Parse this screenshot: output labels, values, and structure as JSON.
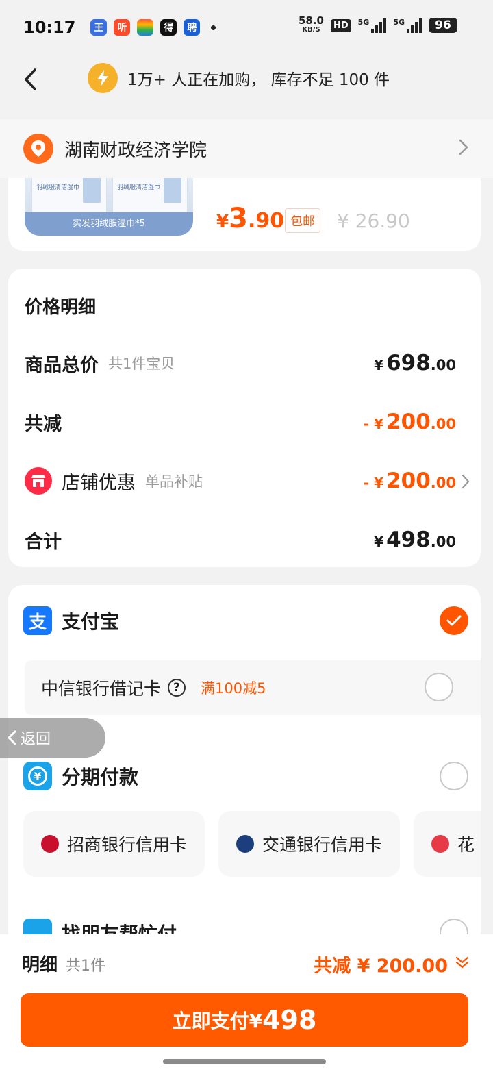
{
  "status_bar": {
    "time": "10:17",
    "net_speed": "58.0",
    "net_unit": "KB/S",
    "hd": "HD",
    "sim1": "5G",
    "sim2": "5G",
    "battery": "96"
  },
  "header": {
    "notice": "1万+ 人正在加购， 库存不足 100 件"
  },
  "address": {
    "text": "湖南财政经济学院"
  },
  "product": {
    "image_caption": "实发羽绒服湿巾*5",
    "pack_title": "羽绒服清洁湿巾",
    "price_currency": "¥",
    "price_int": "3",
    "price_dec": ".90",
    "shipping_tag": "包邮",
    "original_price": "¥ 26.90"
  },
  "price_detail": {
    "title": "价格明细",
    "goods_total": {
      "label": "商品总价",
      "sub": "共1件宝贝",
      "currency": "¥",
      "int": "698",
      "dec": ".00"
    },
    "total_discount": {
      "label": "共减",
      "currency": "- ¥",
      "int": "200",
      "dec": ".00"
    },
    "shop_discount": {
      "label": "店铺优惠",
      "sub": "单品补贴",
      "currency": "- ¥",
      "int": "200",
      "dec": ".00"
    },
    "sum": {
      "label": "合计",
      "currency": "¥",
      "int": "498",
      "dec": ".00"
    }
  },
  "payment": {
    "alipay": {
      "name": "支付宝",
      "icon_char": "支",
      "selected": true
    },
    "bank_card": {
      "name": "中信银行借记卡",
      "help": "?",
      "promo": "满100减5"
    },
    "installment": {
      "name": "分期付款",
      "icon_char": "¥"
    },
    "cards": [
      {
        "name": "招商银行信用卡",
        "icon": "cmb-logo-icon",
        "color": "#c8102e"
      },
      {
        "name": "交通银行信用卡",
        "icon": "bocom-logo-icon",
        "color": "#1d3e7c"
      },
      {
        "name": "花",
        "icon": "huabei-logo-icon",
        "color": "#e63a46"
      }
    ],
    "friend_pay": {
      "name": "找朋友帮忙付"
    }
  },
  "float_back": {
    "label": "返回"
  },
  "bottom_bar": {
    "detail_label": "明细",
    "detail_count": "共1件",
    "total_discount": "共减 ¥ 200.00",
    "pay_label": "立即支付¥",
    "pay_amount": "498"
  },
  "colors": {
    "accent": "#ff5500",
    "alipay_blue": "#1677ff",
    "shop_red": "#ff2a45"
  }
}
